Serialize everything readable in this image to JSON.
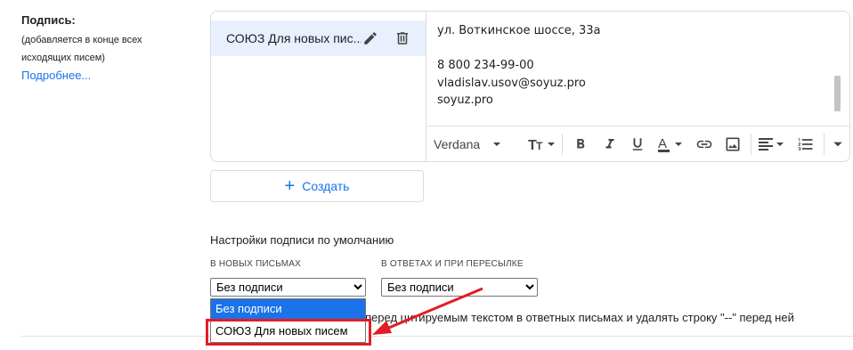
{
  "left": {
    "title": "Подпись:",
    "hint_line1": "(добавляется в конце всех",
    "hint_line2": "исходящих писем)",
    "more_link": "Подробнее..."
  },
  "signature": {
    "name": "СОЮЗ Для новых писем",
    "name_truncated": "СОЮЗ Для новых пис...",
    "lines": [
      "ул. Воткинское шоссе, 33а",
      "",
      "8 800 234-99-00",
      "vladislav.usov@soyuz.pro",
      "soyuz.pro"
    ]
  },
  "toolbar": {
    "font": "Verdana",
    "icons": [
      "text-size-icon",
      "bold-icon",
      "italic-icon",
      "underline-icon",
      "text-color-icon",
      "link-icon",
      "image-icon",
      "align-icon",
      "numbered-list-icon",
      "more-icon"
    ]
  },
  "create_label": "Создать",
  "defaults": {
    "heading": "Настройки подписи по умолчанию",
    "new_label": "В НОВЫХ ПИСЬМАХ",
    "reply_label": "В ОТВЕТАХ И ПРИ ПЕРЕСЫЛКЕ",
    "new_value": "Без подписи",
    "reply_value": "Без подписи",
    "checkbox_text_visible": "перед цитируемым текстом в ответных письмах и удалять строку \"--\" перед ней"
  },
  "dropdown": {
    "options": [
      "Без подписи",
      "СОЮЗ Для новых писем"
    ],
    "highlighted_index": 0
  },
  "colors": {
    "accent": "#1a73e8",
    "annotation": "#e31c25",
    "selected_row": "#e8f0fe"
  }
}
